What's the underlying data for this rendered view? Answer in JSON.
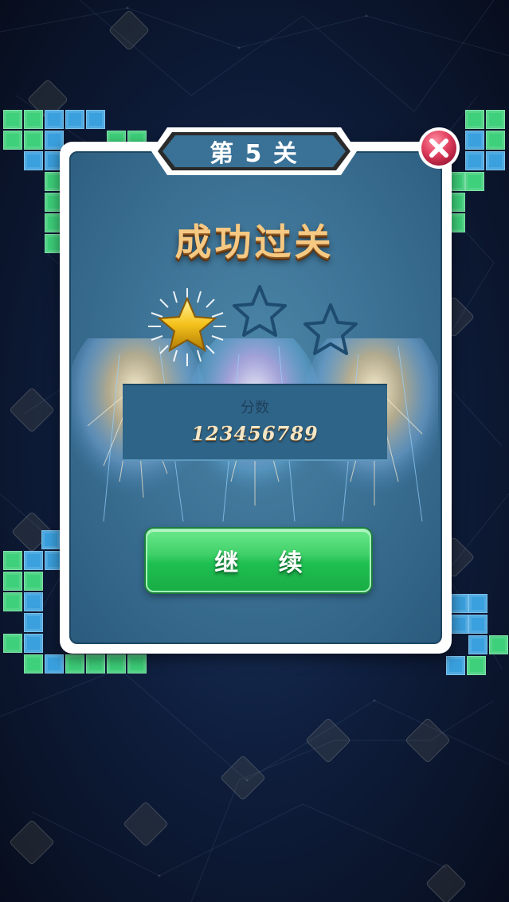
{
  "level": {
    "title": "第 5 关"
  },
  "result": {
    "title": "成功过关"
  },
  "stars": {
    "earned": 1,
    "total": 3
  },
  "score": {
    "label": "分数",
    "value": "123456789"
  },
  "buttons": {
    "continue_label": "继 续"
  },
  "icons": {
    "close": "close-icon",
    "star_filled": "star-filled-icon",
    "star_empty": "star-empty-icon",
    "fireworks": "fireworks-decoration"
  },
  "colors": {
    "panel": "#3a6f92",
    "button_green": "#1fbf52",
    "block_green": "#3ed07a",
    "block_blue": "#3aa0de",
    "close_red": "#e2415f",
    "title_gold": "#f6c983"
  }
}
